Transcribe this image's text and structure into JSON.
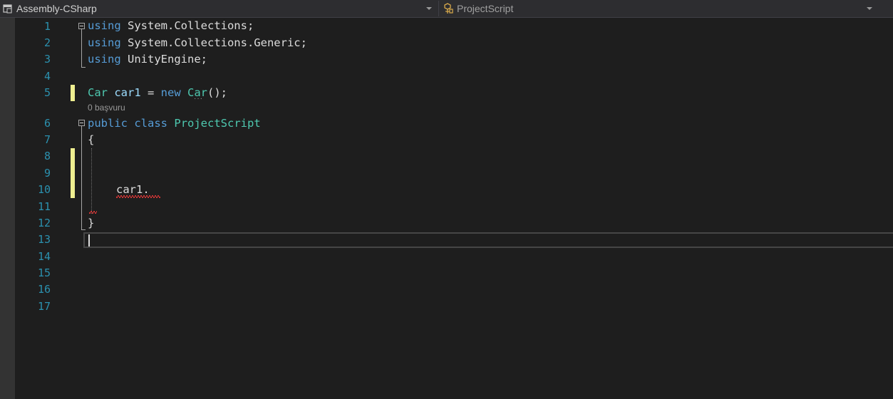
{
  "navbar": {
    "project_dropdown": "Assembly-CSharp",
    "type_dropdown": "ProjectScript",
    "project_icon": "csharp-project-icon",
    "type_icon": "class-icon",
    "caret_icon": "chevron-down-icon"
  },
  "editor": {
    "line_numbers": [
      "1",
      "2",
      "3",
      "4",
      "5",
      "6",
      "7",
      "8",
      "9",
      "10",
      "11",
      "12",
      "13",
      "14",
      "15",
      "16",
      "17"
    ],
    "codelens": "0 başvuru",
    "lines": {
      "l1": {
        "kw": "using",
        "rest": " System.Collections;"
      },
      "l2": {
        "kw": "using",
        "rest": " System.Collections.Generic;"
      },
      "l3": {
        "kw": "using",
        "rest": " UnityEngine;"
      },
      "l5": {
        "type1": "Car",
        "var": " car1",
        "eq": " = ",
        "kw": "new",
        "sp": " ",
        "type2": "Car",
        "rest": "();"
      },
      "l6": {
        "kw1": "public",
        "sp": " ",
        "kw2": "class",
        "sp2": " ",
        "type": "ProjectScript"
      },
      "l7": "{",
      "l10": "car1.",
      "l12": "}"
    },
    "colors": {
      "background": "#1e1e1e",
      "keyword": "#569cd6",
      "type": "#4ec9b0",
      "variable": "#9cdcfe",
      "line_number": "#2b91af",
      "change_marker": "#efef91",
      "error_squiggle": "#ff3b3b"
    }
  }
}
